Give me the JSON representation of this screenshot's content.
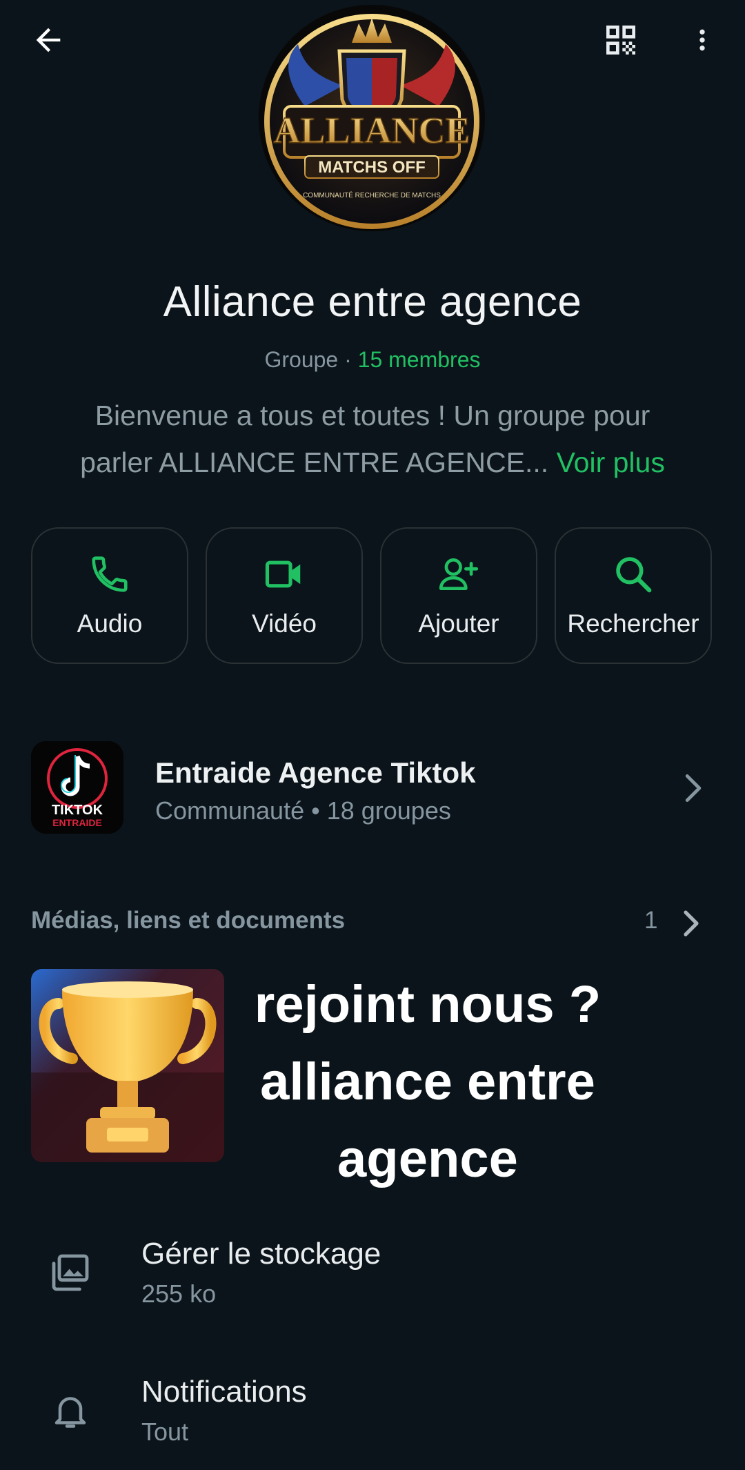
{
  "header": {
    "back_icon": "arrow-left-icon",
    "qr_icon": "qr-code-icon",
    "more_icon": "more-vertical-icon"
  },
  "group": {
    "logo_alt_text": "ALLIANCE MATCHS OFF — COMMUNAUTÉ RECHERCHE DE MATCHS",
    "name": "Alliance entre agence",
    "type_label": "Groupe",
    "separator": " · ",
    "members": "15 membres",
    "description": "Bienvenue a tous et toutes ! Un groupe pour parler ALLIANCE ENTRE AGENCE...",
    "see_more": "Voir plus"
  },
  "actions": [
    {
      "label": "Audio",
      "icon": "phone-icon"
    },
    {
      "label": "Vidéo",
      "icon": "video-icon"
    },
    {
      "label": "Ajouter",
      "icon": "add-person-icon"
    },
    {
      "label": "Rechercher",
      "icon": "search-icon"
    }
  ],
  "community": {
    "avatar_text": "TIKTOK ENTRAIDE AGENCE",
    "title": "Entraide Agence Tiktok",
    "subtitle": "Communauté • 18 groupes"
  },
  "media": {
    "header": "Médias, liens et documents",
    "count": "1",
    "promo_line1": "rejoint nous ?",
    "promo_line2": "alliance entre",
    "promo_line3": "agence"
  },
  "settings": {
    "storage_title": "Gérer le stockage",
    "storage_value": "255 ko",
    "notifications_title": "Notifications",
    "notifications_value": "Tout"
  },
  "colors": {
    "background": "#0b141a",
    "accent": "#21c063",
    "secondary_text": "#8696a0"
  }
}
